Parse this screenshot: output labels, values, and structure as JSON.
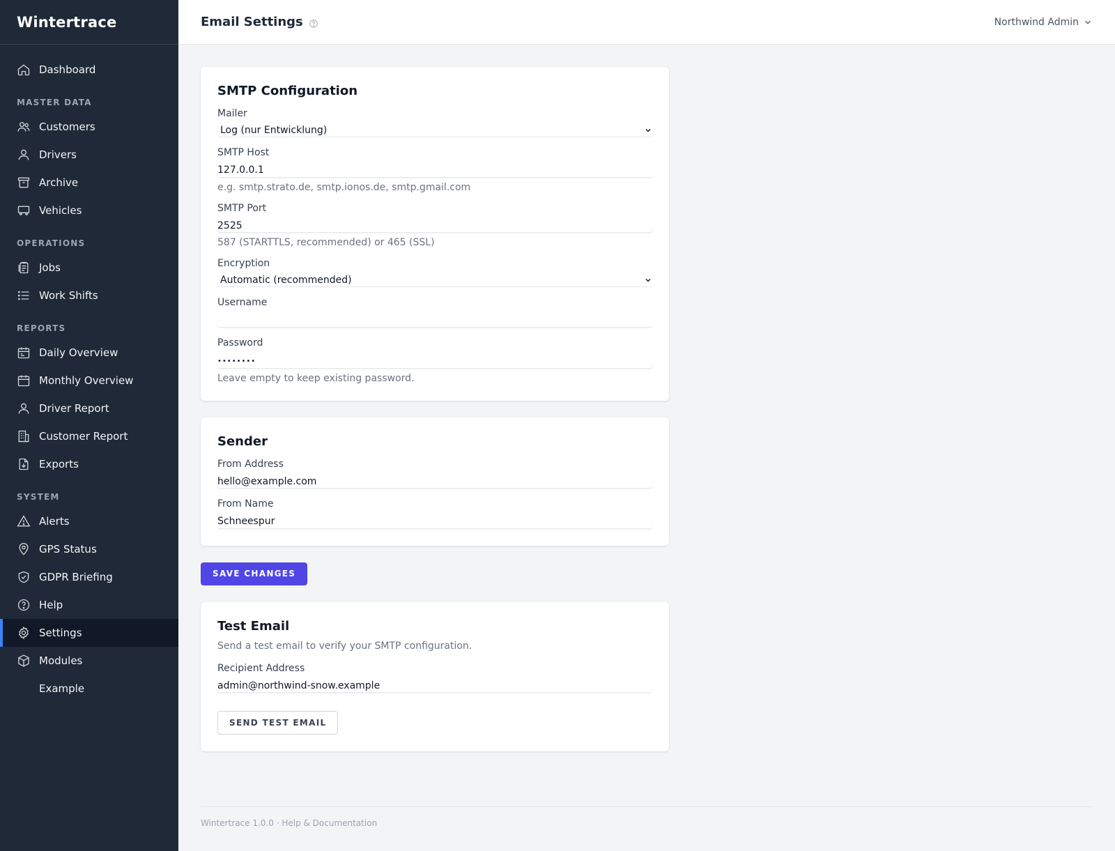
{
  "app": {
    "name": "Wintertrace"
  },
  "header": {
    "title": "Email Settings",
    "user": "Northwind Admin"
  },
  "sidebar": {
    "dashboard": "Dashboard",
    "sections": [
      {
        "label": "MASTER DATA",
        "items": [
          "Customers",
          "Drivers",
          "Archive",
          "Vehicles"
        ]
      },
      {
        "label": "OPERATIONS",
        "items": [
          "Jobs",
          "Work Shifts"
        ]
      },
      {
        "label": "REPORTS",
        "items": [
          "Daily Overview",
          "Monthly Overview",
          "Driver Report",
          "Customer Report",
          "Exports"
        ]
      },
      {
        "label": "SYSTEM",
        "items": [
          "Alerts",
          "GPS Status",
          "GDPR Briefing",
          "Help",
          "Settings",
          "Modules",
          "Example"
        ]
      }
    ],
    "active": "Settings",
    "accent_color": "#3b82f6"
  },
  "smtp": {
    "title": "SMTP Configuration",
    "mailer_label": "Mailer",
    "mailer_value": "Log (nur Entwicklung)",
    "host_label": "SMTP Host",
    "host_value": "127.0.0.1",
    "host_hint": "e.g. smtp.strato.de, smtp.ionos.de, smtp.gmail.com",
    "port_label": "SMTP Port",
    "port_value": "2525",
    "port_hint": "587 (STARTTLS, recommended) or 465 (SSL)",
    "encryption_label": "Encryption",
    "encryption_value": "Automatic (recommended)",
    "username_label": "Username",
    "username_value": "",
    "password_label": "Password",
    "password_value": "••••••••",
    "password_hint": "Leave empty to keep existing password."
  },
  "sender": {
    "title": "Sender",
    "from_address_label": "From Address",
    "from_address_value": "hello@example.com",
    "from_name_label": "From Name",
    "from_name_value": "Schneespur"
  },
  "save_label": "SAVE CHANGES",
  "test": {
    "title": "Test Email",
    "description": "Send a test email to verify your SMTP configuration.",
    "recipient_label": "Recipient Address",
    "recipient_value": "admin@northwind-snow.example",
    "send_label": "SEND TEST EMAIL"
  },
  "footer": {
    "text": "Wintertrace 1.0.0 · Help & Documentation"
  },
  "colors": {
    "primary": "#4f46e5",
    "sidebar_bg": "#1f2937"
  }
}
